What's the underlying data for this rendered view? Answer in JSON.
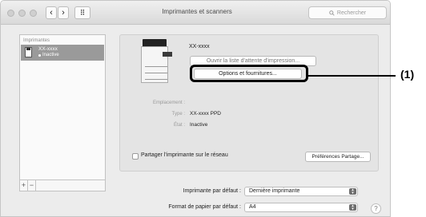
{
  "window": {
    "title": "Imprimantes et scanners"
  },
  "toolbar": {
    "search_placeholder": "Rechercher",
    "back_glyph": "‹",
    "forward_glyph": "›",
    "grid_glyph": "⠿"
  },
  "sidebar": {
    "header": "Imprimantes",
    "items": [
      {
        "name": "XX-xxxx",
        "status": "Inactive",
        "selected": true
      }
    ],
    "add_label": "+",
    "remove_label": "−"
  },
  "details": {
    "printer_name": "XX-xxxx",
    "open_queue_label": "Ouvrir la liste d'attente d'impression...",
    "options_label": "Options et fournitures...",
    "location_label": "Emplacement :",
    "location_value": "",
    "type_label": "Type :",
    "type_value": "XX-xxxx PPD",
    "state_label": "État :",
    "state_value": "Inactive",
    "share_label": "Partager l'imprimante sur le réseau",
    "share_prefs_label": "Préférences Partage..."
  },
  "defaults": {
    "default_printer_label": "Imprimante par défaut :",
    "default_printer_value": "Dernière imprimante",
    "paper_size_label": "Format de papier par défaut :",
    "paper_size_value": "A4"
  },
  "help_label": "?",
  "callout": {
    "label": "(1)"
  },
  "colors": {
    "selection": "#9a9a9a",
    "window_bg": "#ececec",
    "highlight": "#000000"
  }
}
